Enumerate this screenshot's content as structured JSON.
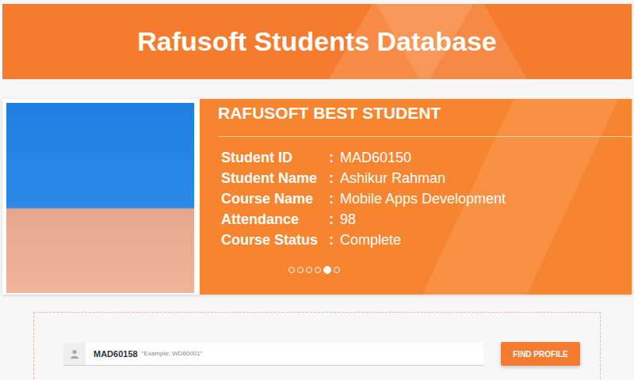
{
  "header": {
    "title": "Rafusoft Students Database"
  },
  "spotlight": {
    "title": "RAFUSOFT BEST STUDENT",
    "separator": ":",
    "fields": [
      {
        "label": "Student ID",
        "value": "MAD60150"
      },
      {
        "label": "Student Name",
        "value": "Ashikur Rahman"
      },
      {
        "label": "Course Name",
        "value": "Mobile Apps Development"
      },
      {
        "label": "Attendance",
        "value": "98"
      },
      {
        "label": "Course Status",
        "value": "Complete"
      }
    ]
  },
  "carousel": {
    "dots": [
      {
        "selected": false
      },
      {
        "selected": false
      },
      {
        "selected": false
      },
      {
        "selected": false
      },
      {
        "selected": true
      },
      {
        "selected": false
      }
    ]
  },
  "search": {
    "value": "MAD60158",
    "hint": "\"Example: WD60001\"",
    "button": "FIND PROFILE"
  }
}
